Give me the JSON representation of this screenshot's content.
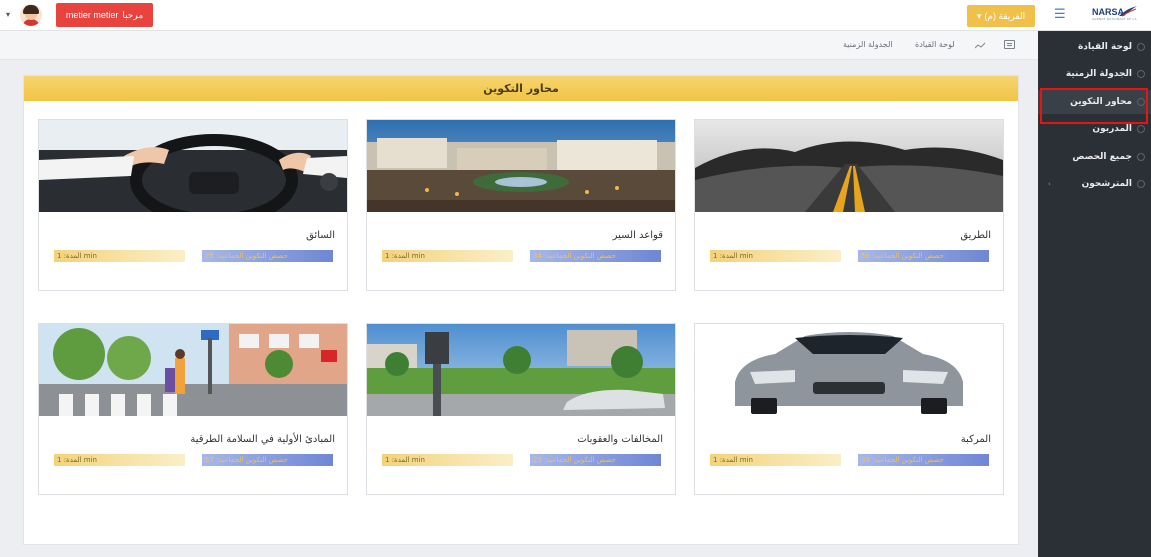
{
  "topbar": {
    "welcome_label": "مرحبا",
    "user_name": "metier metier",
    "fleet_button": "الفريقة (م)",
    "fleet_caret": "▾",
    "user_caret": "▾",
    "logo_text": "NARSA",
    "logo_sub": "AGENCE NATIONALE DE LA SECURITE ROUTIERE",
    "colors": {
      "welcome": "#e8433e",
      "fleet": "#f1c04a"
    }
  },
  "breadcrumb": {
    "items": [
      "لوحة القيادة",
      "الجدولة الزمنية"
    ]
  },
  "sidebar": {
    "items": [
      {
        "label": "لوحة القيادة",
        "icon": "circle-icon"
      },
      {
        "label": "الجدولة الزمنية",
        "icon": "circle-icon"
      },
      {
        "label": "محاور التكوين",
        "icon": "circle-icon",
        "active": true
      },
      {
        "label": "المدربون",
        "icon": "circle-icon"
      },
      {
        "label": "جميع الحصص",
        "icon": "circle-icon"
      },
      {
        "label": "المترشحون",
        "icon": "circle-icon",
        "chevron": "‹"
      }
    ]
  },
  "main": {
    "title": "محاور التكوين",
    "cards": [
      {
        "title": "الطريق",
        "sessions": "حصص التكوين الجماعية: 56",
        "duration": "المدة: 1 min"
      },
      {
        "title": "قواعد السير",
        "sessions": "حصص التكوين الجماعية: 34",
        "duration": "المدة: 1 min"
      },
      {
        "title": "السائق",
        "sessions": "حصص التكوين الجماعية: 25",
        "duration": "المدة: 1 min"
      },
      {
        "title": "المركبة",
        "sessions": "حصص التكوين الجماعية: 33",
        "duration": "المدة: 1 min"
      },
      {
        "title": "المخالفات والعقوبات",
        "sessions": "حصص التكوين الجماعية: 23",
        "duration": "المدة: 1 min"
      },
      {
        "title": "المبادئ الأولية في السلامة الطرقية",
        "sessions": "حصص التكوين الجماعية: 67",
        "duration": "المدة: 1 min"
      }
    ]
  }
}
